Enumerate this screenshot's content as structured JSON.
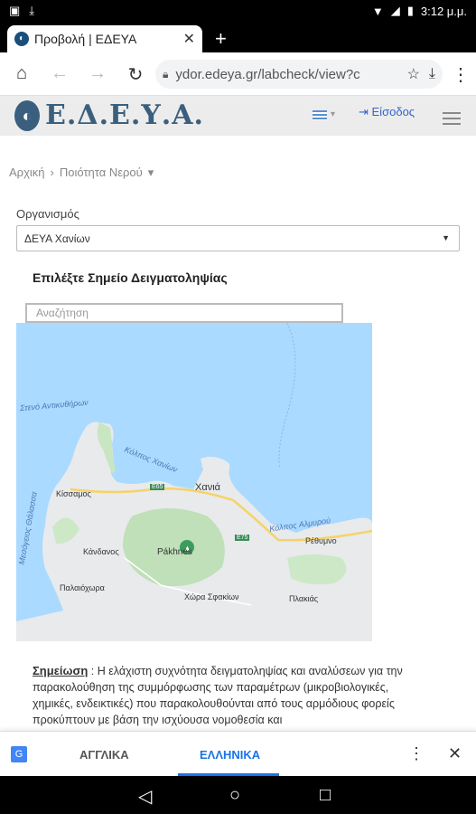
{
  "status": {
    "time": "3:12 μ.μ."
  },
  "browser": {
    "tab_title": "Προβολή | ΕΔΕΥΑ",
    "url": "ydor.edeya.gr/labcheck/view?c"
  },
  "site": {
    "logo_text": "Ε.Δ.Ε.Υ.Α.",
    "login_label": "Είσοδος"
  },
  "breadcrumb": {
    "home": "Αρχική",
    "section": "Ποιότητα Νερού"
  },
  "form": {
    "org_label": "Οργανισμός",
    "org_value": "ΔΕΥΑ Χανίων",
    "point_title": "Επιλέξτε Σημείο Δειγματοληψίας",
    "search_placeholder": "Αναζήτηση"
  },
  "map": {
    "labels": {
      "chania": "Χανιά",
      "kissamos": "Κίσσαμος",
      "kandanos": "Κάνδανος",
      "paleochora": "Παλαιόχωρα",
      "chora_sfakion": "Χώρα Σφακίων",
      "rethymno": "Ρέθυμνο",
      "plakias": "Πλακιάς",
      "pakhnes": "Pákhnes",
      "gulf_chania": "Κόλπος Χανίων",
      "gulf_almyrou": "Κόλπος Αλμυρού",
      "antikythira": "Στενό Αντικυθήρων",
      "mediterranean": "Μεσόγειος Θάλασσα",
      "e65": "E65",
      "e75": "E75"
    }
  },
  "note": {
    "label": "Σημείωση",
    "text": " : Η ελάχιστη συχνότητα δειγματοληψίας και αναλύσεων για την παρακολούθηση της συμμόρφωσης των παραμέτρων (μικροβιολογικές, χημικές, ενδεικτικές) που παρακολουθούνται από τους αρμόδιους φορείς προκύπτουν με βάση την ισχύουσα νομοθεσία και"
  },
  "translate": {
    "english": "ΑΓΓΛΙΚΑ",
    "greek": "ΕΛΛΗΝΙΚΑ"
  }
}
